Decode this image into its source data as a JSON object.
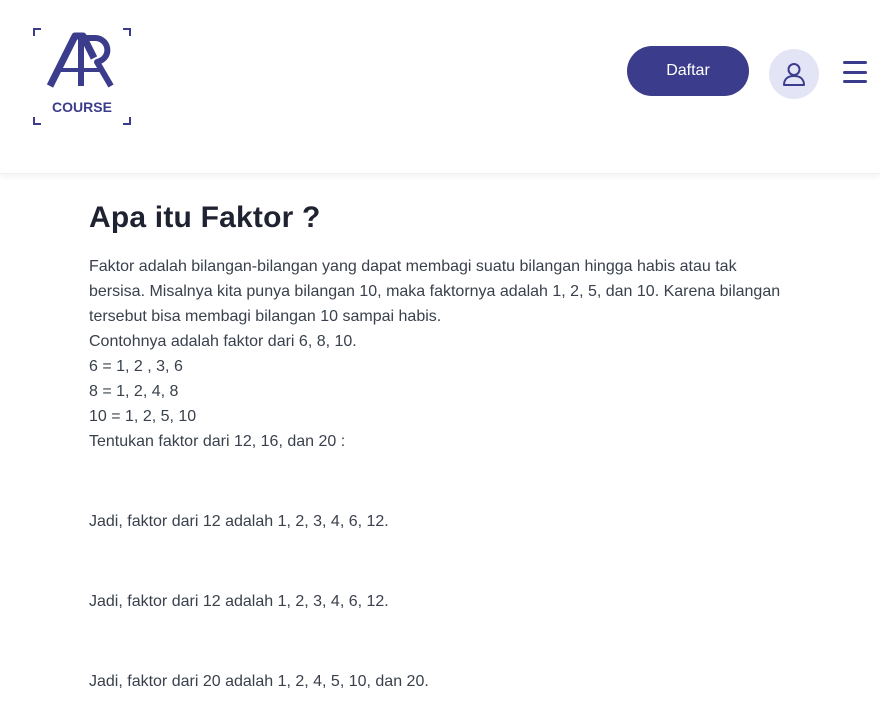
{
  "header": {
    "logo_text": "COURSE",
    "logo_mark": "AR",
    "register_label": "Daftar",
    "profile_icon": "user-icon",
    "menu_icon": "hamburger-menu-icon",
    "brand_color": "#3b3d8c"
  },
  "article": {
    "title": "Apa itu Faktor ?",
    "lines": [
      "Faktor adalah bilangan-bilangan yang dapat membagi suatu bilangan hingga habis atau tak",
      "bersisa. Misalnya kita punya bilangan 10, maka faktornya adalah 1, 2, 5, dan 10. Karena bilangan",
      "tersebut bisa membagi bilangan 10 sampai habis.",
      "Contohnya adalah faktor dari 6, 8, 10.",
      "6 = 1, 2 , 3, 6",
      "8 = 1, 2, 4, 8",
      "10 = 1, 2, 5, 10",
      "Tentukan faktor dari 12, 16, dan 20 :"
    ],
    "conclusions": [
      "Jadi, faktor dari 12 adalah 1, 2, 3, 4, 6, 12.",
      "Jadi, faktor dari 12 adalah 1, 2, 3, 4, 6, 12.",
      "Jadi, faktor dari 20 adalah 1, 2, 4, 5, 10, dan 20."
    ]
  }
}
